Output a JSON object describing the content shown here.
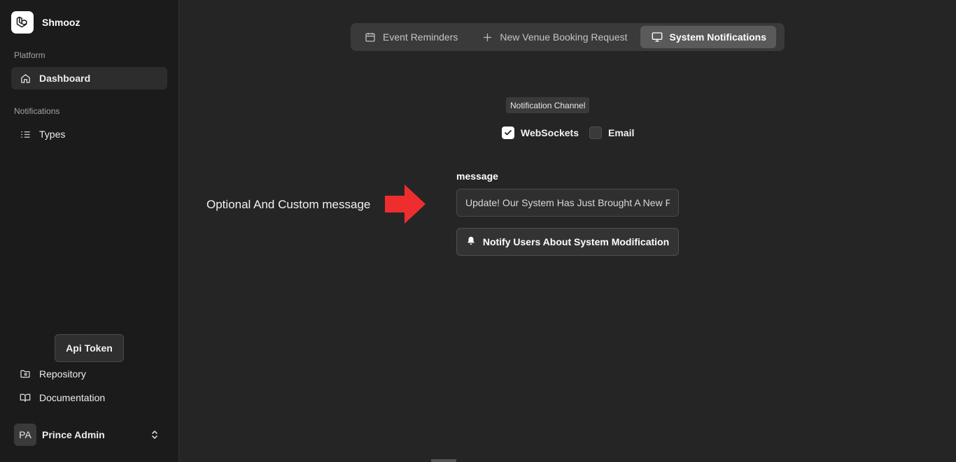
{
  "app": {
    "name": "Shmooz"
  },
  "sidebar": {
    "platform_label": "Platform",
    "dashboard_label": "Dashboard",
    "notifications_label": "Notifications",
    "types_label": "Types",
    "api_token_label": "Api Token",
    "repository_label": "Repository",
    "documentation_label": "Documentation",
    "user": {
      "initials": "PA",
      "name": "Prince Admin"
    }
  },
  "tabs": [
    {
      "label": "Event Reminders",
      "icon": "calendar-icon",
      "active": false
    },
    {
      "label": "New Venue Booking Request",
      "icon": "plus-icon",
      "active": false
    },
    {
      "label": "System Notifications",
      "icon": "monitor-icon",
      "active": true
    }
  ],
  "main": {
    "channel_badge": "Notification Channel",
    "channels": [
      {
        "label": "WebSockets",
        "checked": true
      },
      {
        "label": "Email",
        "checked": false
      }
    ],
    "message_label": "message",
    "message_value": "Update! Our System Has Just Brought A New Feature",
    "notify_button_label": "Notify Users About System Modification",
    "annotation_text": "Optional And Custom message"
  },
  "colors": {
    "arrow": "#ee2e2e",
    "background": "#252525",
    "sidebar": "#1b1b1b"
  }
}
